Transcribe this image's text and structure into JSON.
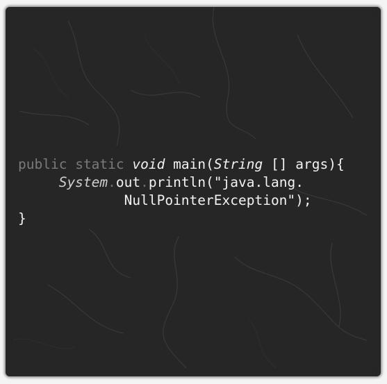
{
  "code": {
    "line1": {
      "kw_public": "public",
      "kw_static": "static",
      "kw_void": "void",
      "method": "main(",
      "type": "String",
      "params": " [] args){"
    },
    "line2": {
      "class": "System",
      "dot1": ".",
      "field": "out",
      "dot2": ".",
      "call": "println(\"java.lang."
    },
    "line3": {
      "text": "NullPointerException\");"
    },
    "line4": {
      "text": "}"
    }
  },
  "colors": {
    "background": "#262626",
    "keyword": "#7a7a7a",
    "text": "#f2f2f2",
    "frame": "#f4f4f4"
  }
}
